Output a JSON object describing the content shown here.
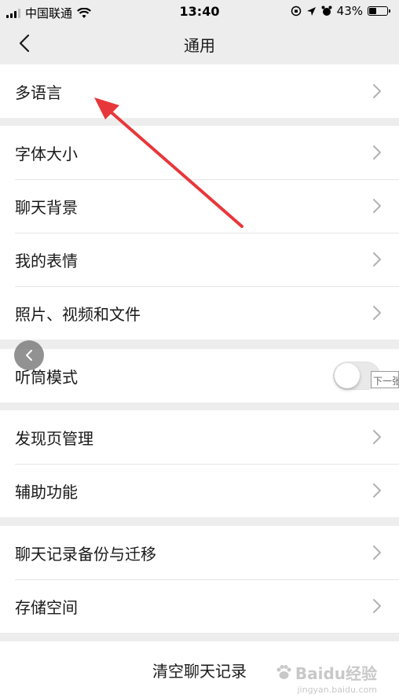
{
  "status_bar": {
    "carrier": "中国联通",
    "time": "13:40",
    "battery": "43%",
    "battery_level": 0.43
  },
  "nav": {
    "title": "通用",
    "back_icon": "chevron-left-icon"
  },
  "groups": [
    {
      "items": [
        "多语言"
      ]
    },
    {
      "items": [
        "字体大小",
        "聊天背景",
        "我的表情",
        "照片、视频和文件"
      ]
    },
    {
      "items": [
        "听筒模式"
      ]
    },
    {
      "items": [
        "发现页管理",
        "辅助功能"
      ]
    },
    {
      "items": [
        "聊天记录备份与迁移",
        "存储空间"
      ]
    },
    {
      "items": [
        "清空聊天记录"
      ]
    }
  ],
  "toggle": {
    "on": false,
    "tooltip": "下一张"
  },
  "watermark": {
    "brand": "Baidu经验",
    "url": "jingyan.baidu.com"
  },
  "colors": {
    "background": "#ededed",
    "arrow": "#e8373a",
    "divider": "#e6e6e6"
  }
}
